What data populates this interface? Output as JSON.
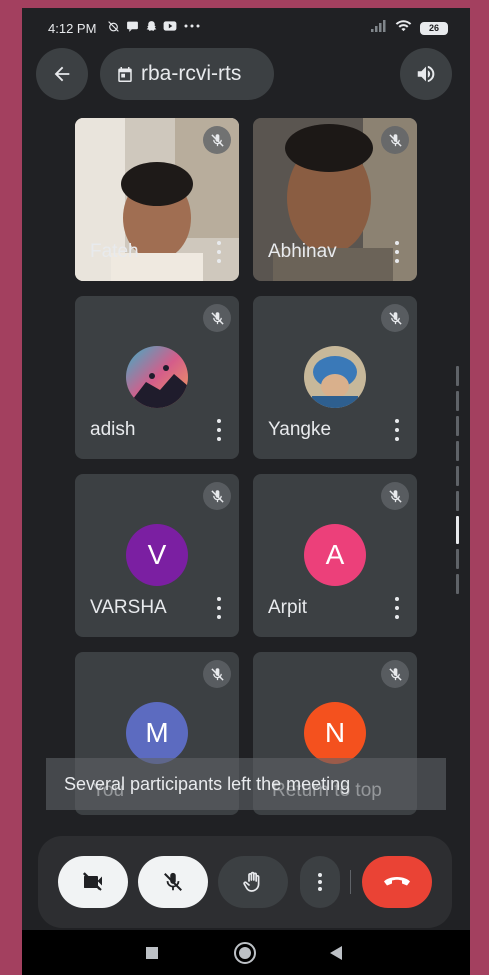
{
  "status": {
    "time": "4:12 PM",
    "battery": "26"
  },
  "header": {
    "meeting_code": "rba-rcvi-rts"
  },
  "participants": [
    {
      "name": "Fateh",
      "type": "video",
      "muted": true
    },
    {
      "name": "Abhinav",
      "type": "video",
      "muted": true
    },
    {
      "name": "adish",
      "type": "photo",
      "muted": true
    },
    {
      "name": "Yangke",
      "type": "photo",
      "muted": true
    },
    {
      "name": "VARSHA",
      "type": "initial",
      "initial": "V",
      "color": "#7b1fa2",
      "muted": true
    },
    {
      "name": "Arpit",
      "type": "initial",
      "initial": "A",
      "color": "#ec407a",
      "muted": true
    },
    {
      "name": "You",
      "type": "initial",
      "initial": "M",
      "color": "#5c6bc0",
      "muted": true
    },
    {
      "name": "Return to top",
      "type": "initial",
      "initial": "N",
      "color": "#f4511e",
      "muted": true
    }
  ],
  "toast": {
    "message": "Several participants left the meeting"
  },
  "controls": {
    "camera": "camera-off",
    "mic": "mic-off",
    "hand": "raise-hand",
    "more": "more-options",
    "end": "end-call",
    "accent_red": "#ea4335"
  }
}
